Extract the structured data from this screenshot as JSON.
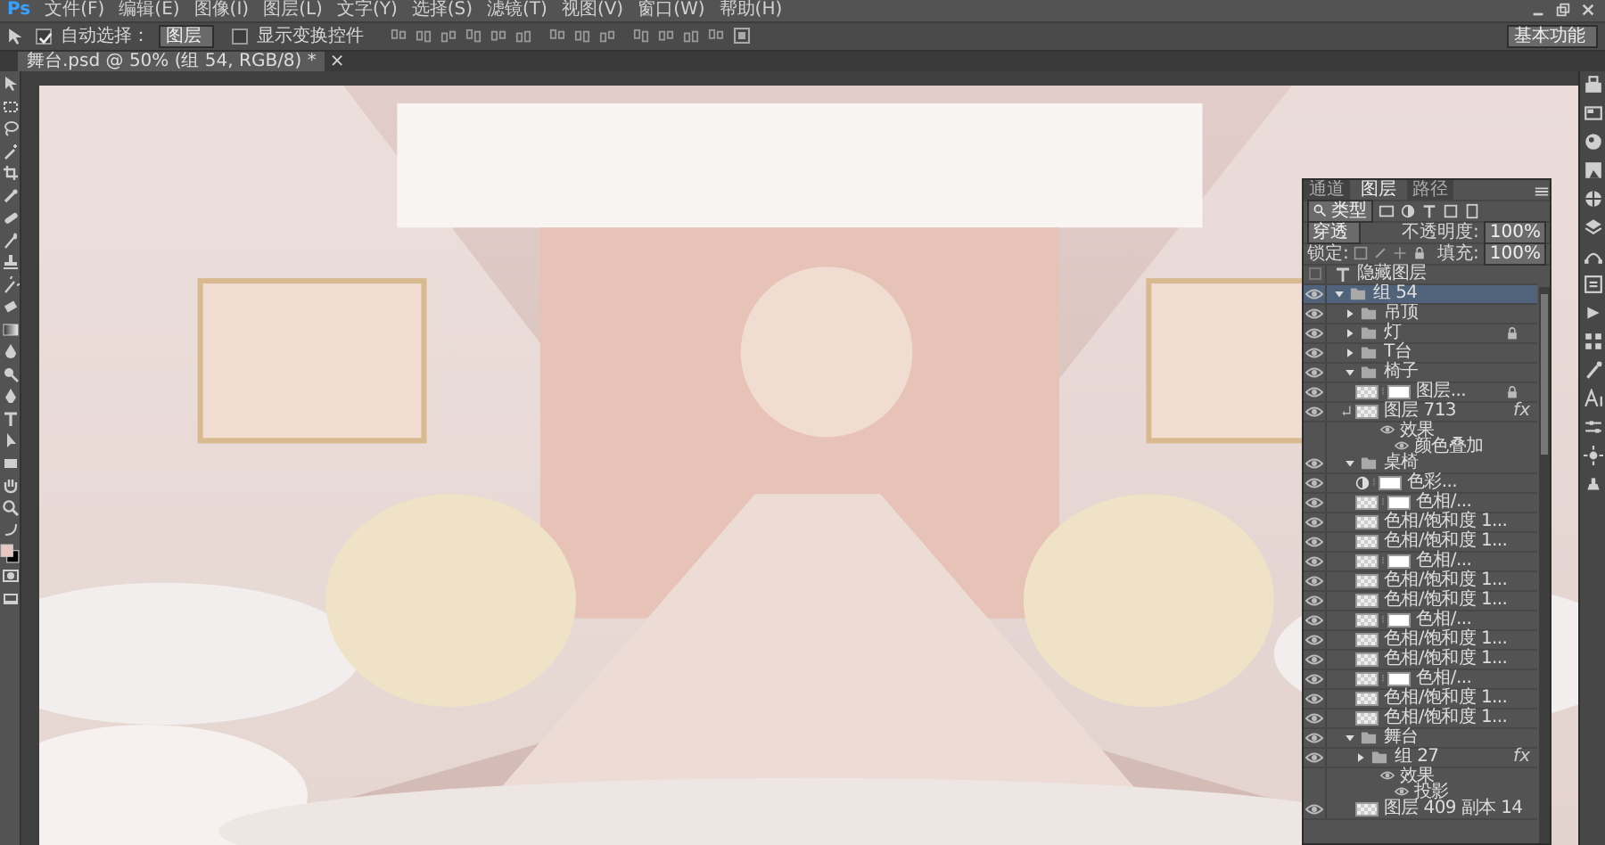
{
  "app": {
    "logo": "Ps"
  },
  "menu": [
    "文件(F)",
    "编辑(E)",
    "图像(I)",
    "图层(L)",
    "文字(Y)",
    "选择(S)",
    "滤镜(T)",
    "视图(V)",
    "窗口(W)",
    "帮助(H)"
  ],
  "options_bar": {
    "auto_select": {
      "label": "自动选择：",
      "checked": true
    },
    "auto_select_target": "图层",
    "show_transform": {
      "label": "显示变换控件",
      "checked": false
    },
    "workspace": "基本功能"
  },
  "document_tab": {
    "title": "舞台.psd @ 50% (组 54, RGB/8) *",
    "close": "×"
  },
  "layers_panel": {
    "tabs": [
      {
        "label": "通道",
        "selected": false
      },
      {
        "label": "图层",
        "selected": true
      },
      {
        "label": "路径",
        "selected": false
      }
    ],
    "filter": "类型",
    "blend_mode": "穿透",
    "opacity_label": "不透明度:",
    "opacity": "100%",
    "lock_label": "锁定:",
    "fill_label": "填充:",
    "fill": "100%",
    "layers": [
      {
        "kind": "text",
        "name": "隐藏图层",
        "visible": false,
        "selected": false
      },
      {
        "kind": "group",
        "name": "组 54",
        "visible": true,
        "selected": true,
        "expanded": true,
        "children": [
          {
            "kind": "group",
            "name": "吊顶",
            "visible": true,
            "selected": false,
            "expanded": false
          },
          {
            "kind": "group",
            "name": "灯",
            "visible": true,
            "selected": false,
            "expanded": false,
            "locked": true
          },
          {
            "kind": "group",
            "name": "T台",
            "visible": true,
            "selected": false,
            "expanded": false
          },
          {
            "kind": "group",
            "name": "椅子",
            "visible": true,
            "selected": false,
            "expanded": true,
            "children": [
              {
                "kind": "layer",
                "name": "图层...",
                "visible": true,
                "selected": false,
                "mask": true,
                "locked": true
              },
              {
                "kind": "layer",
                "name": "图层 713",
                "visible": true,
                "selected": false,
                "clipped": true,
                "fx": "fx",
                "effects_label": "效果",
                "effects": [
                  "颜色叠加"
                ]
              }
            ]
          },
          {
            "kind": "group",
            "name": "桌椅",
            "visible": true,
            "selected": false,
            "expanded": true,
            "children": [
              {
                "kind": "adjustment",
                "name": "色彩...",
                "visible": true,
                "selected": false,
                "mask": true
              },
              {
                "kind": "layer",
                "name": "色相/...",
                "visible": true,
                "selected": false,
                "mask": true
              },
              {
                "kind": "layer",
                "name": "色相/饱和度 1...",
                "visible": true,
                "selected": false
              },
              {
                "kind": "layer",
                "name": "色相/饱和度 1...",
                "visible": true,
                "selected": false
              },
              {
                "kind": "layer",
                "name": "色相/...",
                "visible": true,
                "selected": false,
                "mask": true
              },
              {
                "kind": "layer",
                "name": "色相/饱和度 1...",
                "visible": true,
                "selected": false
              },
              {
                "kind": "layer",
                "name": "色相/饱和度 1...",
                "visible": true,
                "selected": false
              },
              {
                "kind": "layer",
                "name": "色相/...",
                "visible": true,
                "selected": false,
                "mask": true
              },
              {
                "kind": "layer",
                "name": "色相/饱和度 1...",
                "visible": true,
                "selected": false
              },
              {
                "kind": "layer",
                "name": "色相/饱和度 1...",
                "visible": true,
                "selected": false
              },
              {
                "kind": "layer",
                "name": "色相/...",
                "visible": true,
                "selected": false,
                "mask": true
              },
              {
                "kind": "layer",
                "name": "色相/饱和度 1...",
                "visible": true,
                "selected": false
              },
              {
                "kind": "layer",
                "name": "色相/饱和度 1...",
                "visible": true,
                "selected": false
              }
            ]
          },
          {
            "kind": "group",
            "name": "舞台",
            "visible": true,
            "selected": false,
            "expanded": true,
            "children": [
              {
                "kind": "group",
                "name": "组 27",
                "visible": true,
                "selected": false,
                "expanded": false,
                "fx": "fx",
                "effects_label": "效果",
                "effects": [
                  "投影"
                ]
              },
              {
                "kind": "layer",
                "name": "图层 409 副本 14",
                "visible": true,
                "selected": false
              }
            ]
          }
        ]
      }
    ]
  }
}
